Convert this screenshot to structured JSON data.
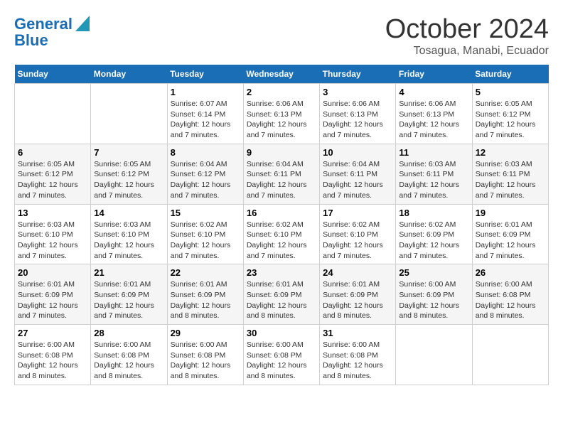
{
  "logo": {
    "line1": "General",
    "line2": "Blue"
  },
  "title": "October 2024",
  "location": "Tosagua, Manabi, Ecuador",
  "days_of_week": [
    "Sunday",
    "Monday",
    "Tuesday",
    "Wednesday",
    "Thursday",
    "Friday",
    "Saturday"
  ],
  "weeks": [
    [
      {
        "day": "",
        "info": ""
      },
      {
        "day": "",
        "info": ""
      },
      {
        "day": "1",
        "info": "Sunrise: 6:07 AM\nSunset: 6:14 PM\nDaylight: 12 hours and 7 minutes."
      },
      {
        "day": "2",
        "info": "Sunrise: 6:06 AM\nSunset: 6:13 PM\nDaylight: 12 hours and 7 minutes."
      },
      {
        "day": "3",
        "info": "Sunrise: 6:06 AM\nSunset: 6:13 PM\nDaylight: 12 hours and 7 minutes."
      },
      {
        "day": "4",
        "info": "Sunrise: 6:06 AM\nSunset: 6:13 PM\nDaylight: 12 hours and 7 minutes."
      },
      {
        "day": "5",
        "info": "Sunrise: 6:05 AM\nSunset: 6:12 PM\nDaylight: 12 hours and 7 minutes."
      }
    ],
    [
      {
        "day": "6",
        "info": "Sunrise: 6:05 AM\nSunset: 6:12 PM\nDaylight: 12 hours and 7 minutes."
      },
      {
        "day": "7",
        "info": "Sunrise: 6:05 AM\nSunset: 6:12 PM\nDaylight: 12 hours and 7 minutes."
      },
      {
        "day": "8",
        "info": "Sunrise: 6:04 AM\nSunset: 6:12 PM\nDaylight: 12 hours and 7 minutes."
      },
      {
        "day": "9",
        "info": "Sunrise: 6:04 AM\nSunset: 6:11 PM\nDaylight: 12 hours and 7 minutes."
      },
      {
        "day": "10",
        "info": "Sunrise: 6:04 AM\nSunset: 6:11 PM\nDaylight: 12 hours and 7 minutes."
      },
      {
        "day": "11",
        "info": "Sunrise: 6:03 AM\nSunset: 6:11 PM\nDaylight: 12 hours and 7 minutes."
      },
      {
        "day": "12",
        "info": "Sunrise: 6:03 AM\nSunset: 6:11 PM\nDaylight: 12 hours and 7 minutes."
      }
    ],
    [
      {
        "day": "13",
        "info": "Sunrise: 6:03 AM\nSunset: 6:10 PM\nDaylight: 12 hours and 7 minutes."
      },
      {
        "day": "14",
        "info": "Sunrise: 6:03 AM\nSunset: 6:10 PM\nDaylight: 12 hours and 7 minutes."
      },
      {
        "day": "15",
        "info": "Sunrise: 6:02 AM\nSunset: 6:10 PM\nDaylight: 12 hours and 7 minutes."
      },
      {
        "day": "16",
        "info": "Sunrise: 6:02 AM\nSunset: 6:10 PM\nDaylight: 12 hours and 7 minutes."
      },
      {
        "day": "17",
        "info": "Sunrise: 6:02 AM\nSunset: 6:10 PM\nDaylight: 12 hours and 7 minutes."
      },
      {
        "day": "18",
        "info": "Sunrise: 6:02 AM\nSunset: 6:09 PM\nDaylight: 12 hours and 7 minutes."
      },
      {
        "day": "19",
        "info": "Sunrise: 6:01 AM\nSunset: 6:09 PM\nDaylight: 12 hours and 7 minutes."
      }
    ],
    [
      {
        "day": "20",
        "info": "Sunrise: 6:01 AM\nSunset: 6:09 PM\nDaylight: 12 hours and 7 minutes."
      },
      {
        "day": "21",
        "info": "Sunrise: 6:01 AM\nSunset: 6:09 PM\nDaylight: 12 hours and 7 minutes."
      },
      {
        "day": "22",
        "info": "Sunrise: 6:01 AM\nSunset: 6:09 PM\nDaylight: 12 hours and 8 minutes."
      },
      {
        "day": "23",
        "info": "Sunrise: 6:01 AM\nSunset: 6:09 PM\nDaylight: 12 hours and 8 minutes."
      },
      {
        "day": "24",
        "info": "Sunrise: 6:01 AM\nSunset: 6:09 PM\nDaylight: 12 hours and 8 minutes."
      },
      {
        "day": "25",
        "info": "Sunrise: 6:00 AM\nSunset: 6:09 PM\nDaylight: 12 hours and 8 minutes."
      },
      {
        "day": "26",
        "info": "Sunrise: 6:00 AM\nSunset: 6:08 PM\nDaylight: 12 hours and 8 minutes."
      }
    ],
    [
      {
        "day": "27",
        "info": "Sunrise: 6:00 AM\nSunset: 6:08 PM\nDaylight: 12 hours and 8 minutes."
      },
      {
        "day": "28",
        "info": "Sunrise: 6:00 AM\nSunset: 6:08 PM\nDaylight: 12 hours and 8 minutes."
      },
      {
        "day": "29",
        "info": "Sunrise: 6:00 AM\nSunset: 6:08 PM\nDaylight: 12 hours and 8 minutes."
      },
      {
        "day": "30",
        "info": "Sunrise: 6:00 AM\nSunset: 6:08 PM\nDaylight: 12 hours and 8 minutes."
      },
      {
        "day": "31",
        "info": "Sunrise: 6:00 AM\nSunset: 6:08 PM\nDaylight: 12 hours and 8 minutes."
      },
      {
        "day": "",
        "info": ""
      },
      {
        "day": "",
        "info": ""
      }
    ]
  ]
}
